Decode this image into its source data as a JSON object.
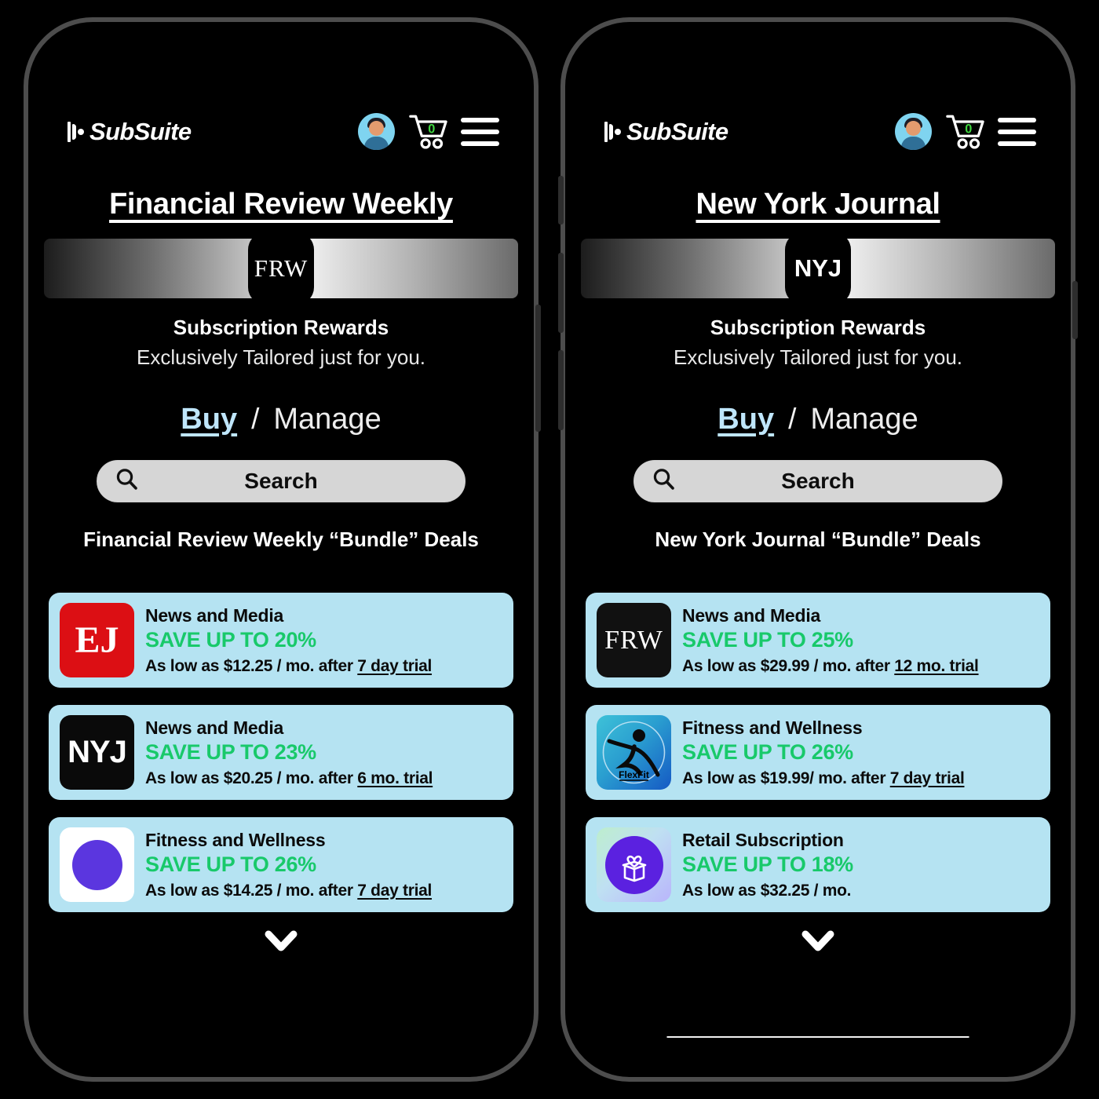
{
  "app": {
    "brand_name": "SubSuite",
    "brand_mark_icon": "subsuite-logo-icon",
    "avatar_icon": "user-avatar-icon",
    "cart_icon": "shopping-cart-icon",
    "cart_count": "0",
    "menu_icon": "hamburger-menu-icon"
  },
  "common": {
    "rewards_title": "Subscription Rewards",
    "rewards_subtitle": "Exclusively Tailored just for you.",
    "tab_buy": "Buy",
    "tab_separator": "/",
    "tab_manage": "Manage",
    "search_label": "Search",
    "search_icon": "search-icon",
    "chevron_icon": "chevron-down-icon",
    "accent_blue": "#bfe6fb",
    "card_bg": "#b5e3f2",
    "save_green": "#18c96a"
  },
  "phones": [
    {
      "id": "left",
      "pub_title": "Financial Review Weekly",
      "badge_text": "FRW",
      "badge_style": "serif",
      "deals_heading": "Financial Review Weekly “Bundle” Deals",
      "has_home_indicator": false,
      "deals": [
        {
          "logo_text": "EJ",
          "logo_kind": "ej",
          "category": "News and Media",
          "save": "SAVE UP TO 20%",
          "price_prefix": "As low as $12.25 / mo. after ",
          "price_trial": "7 day trial"
        },
        {
          "logo_text": "NYJ",
          "logo_kind": "nyj",
          "category": "News and Media",
          "save": "SAVE UP TO 23%",
          "price_prefix": "As low as $20.25 / mo. after ",
          "price_trial": "6 mo.  trial"
        },
        {
          "logo_text": "",
          "logo_kind": "purple-dot",
          "category": "Fitness and Wellness",
          "save": "SAVE UP TO 26%",
          "price_prefix": "As low as $14.25 / mo. after ",
          "price_trial": "7 day  trial"
        }
      ]
    },
    {
      "id": "right",
      "pub_title": "New York Journal",
      "badge_text": "NYJ",
      "badge_style": "sans",
      "deals_heading": "New York Journal “Bundle” Deals",
      "has_home_indicator": true,
      "deals": [
        {
          "logo_text": "FRW",
          "logo_kind": "frw",
          "category": "News and Media",
          "save": "SAVE UP TO 25%",
          "price_prefix": "As low as $29.99 / mo. after ",
          "price_trial": "12 mo. trial"
        },
        {
          "logo_text": "FlexFit",
          "logo_kind": "flexfit",
          "category": "Fitness and Wellness",
          "save": "SAVE UP TO 26%",
          "price_prefix": "As low as $19.99/ mo. after ",
          "price_trial": "7 day  trial"
        },
        {
          "logo_text": "",
          "logo_kind": "retail",
          "category": "Retail Subscription",
          "save": "SAVE UP TO 18%",
          "price_prefix": "As low as $32.25 / mo.",
          "price_trial": ""
        }
      ]
    }
  ]
}
